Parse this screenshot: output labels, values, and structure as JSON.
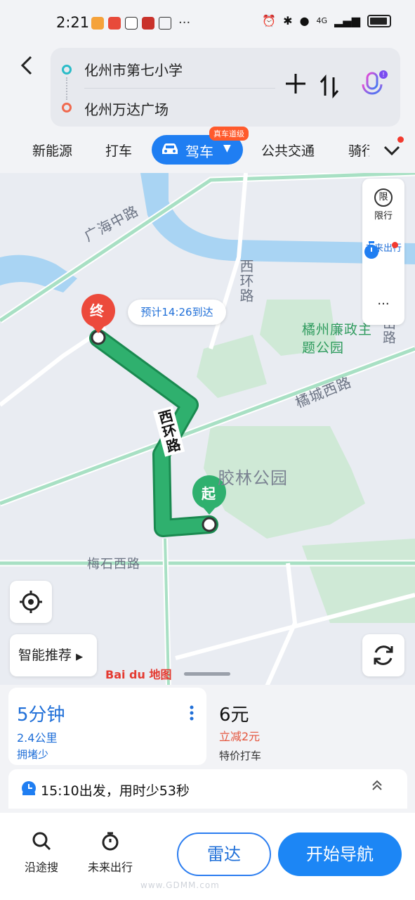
{
  "status_bar": {
    "time": "2:21",
    "network": "4G"
  },
  "header": {
    "origin": "化州市第七小学",
    "destination": "化州万达广场"
  },
  "tabs": {
    "items": [
      "新能源",
      "打车",
      "驾车",
      "公共交通",
      "骑行"
    ],
    "active": "驾车",
    "active_badge": "真车道级"
  },
  "map": {
    "labels": {
      "road_guanghai": "广海中路",
      "road_xihuan": "西环路",
      "road_xihuan_route": "西环路",
      "park_lianzheng": "橘州廉政主题公园",
      "road_shan": "山路",
      "road_jucheng": "橘城西路",
      "park_jiaolin": "胶林公园",
      "road_meishi": "梅石西路"
    },
    "eta": "预计14:26到达",
    "end_marker": "终",
    "start_marker": "起",
    "tools": {
      "restrict": "限行",
      "restrict_icon": "限",
      "future": "未来出行",
      "more": "···"
    },
    "smart_recommend": "智能推荐",
    "logo": "Bai du 地图"
  },
  "route": {
    "time": "5分钟",
    "distance": "2.4公里",
    "traffic": "拥堵少"
  },
  "taxi": {
    "price": "6元",
    "discount": "立减2元",
    "label": "特价打车"
  },
  "depart": "15:10出发，用时少53秒",
  "actions": {
    "search_along": "沿途搜",
    "future_trip": "未来出行",
    "radar": "雷达",
    "start_nav": "开始导航"
  },
  "watermark": "www.GDMM.com",
  "colors": {
    "accent": "#1f7ef2",
    "route": "#2fb06e",
    "discount": "#e4553d"
  }
}
